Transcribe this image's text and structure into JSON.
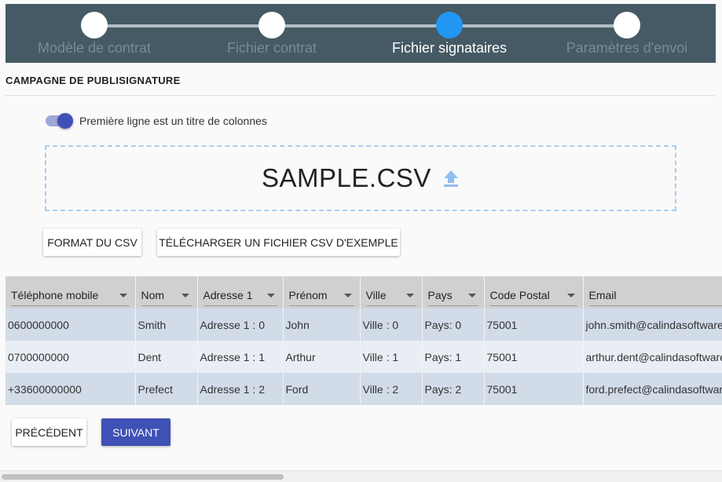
{
  "stepper": {
    "steps": [
      {
        "label": "Modèle de contrat",
        "state": "done"
      },
      {
        "label": "Fichier contrat",
        "state": "done"
      },
      {
        "label": "Fichier signataires",
        "state": "active"
      },
      {
        "label": "Paramètres d'envoi",
        "state": "todo"
      }
    ],
    "active_color": "#2196f3",
    "background": "#455a64"
  },
  "page": {
    "title": "CAMPAGNE DE PUBLISIGNATURE"
  },
  "header_toggle": {
    "label": "Première ligne est un titre de colonnes",
    "checked": true
  },
  "dropzone": {
    "filename": "SAMPLE.CSV",
    "icon": "upload-icon"
  },
  "actions": {
    "format_label": "FORMAT DU CSV",
    "download_label": "TÉLÉCHARGER UN FICHIER CSV D'EXEMPLE"
  },
  "table": {
    "columns": [
      "Téléphone mobile",
      "Nom",
      "Adresse 1",
      "Prénom",
      "Ville",
      "Pays",
      "Code Postal",
      "Email"
    ],
    "rows": [
      [
        "0600000000",
        "Smith",
        "Adresse 1 : 0",
        "John",
        "Ville : 0",
        "Pays: 0",
        "75001",
        "john.smith@calindasoftware.com"
      ],
      [
        "0700000000",
        "Dent",
        "Adresse 1 : 1",
        "Arthur",
        "Ville : 1",
        "Pays: 1",
        "75001",
        "arthur.dent@calindasoftware.com"
      ],
      [
        "+33600000000",
        "Prefect",
        "Adresse 1 : 2",
        "Ford",
        "Ville : 2",
        "Pays: 2",
        "75001",
        "ford.prefect@calindasoftware.com"
      ]
    ]
  },
  "nav": {
    "previous_label": "PRÉCÉDENT",
    "next_label": "SUIVANT"
  },
  "colors": {
    "primary": "#3f51b5",
    "row_odd": "#d2dbe8",
    "row_even": "#e9eef5"
  }
}
